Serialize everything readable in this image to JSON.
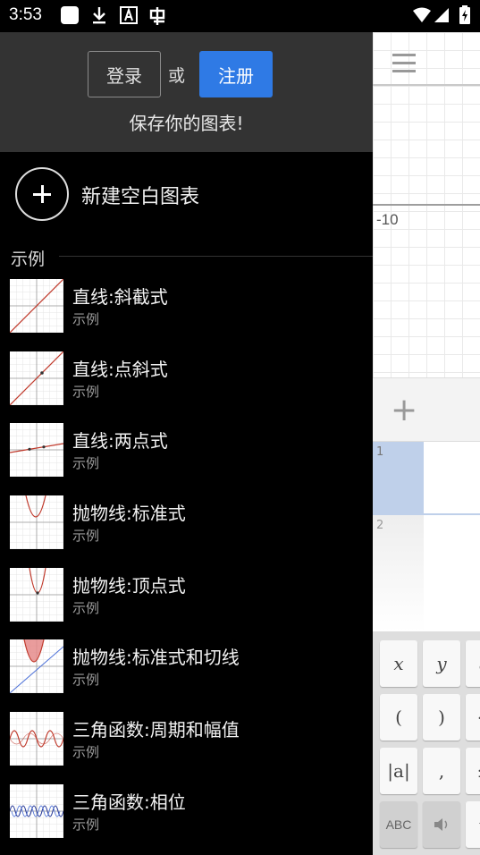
{
  "status_bar": {
    "time": "3:53",
    "icons": [
      "app-square-icon",
      "download-icon",
      "font-a-icon",
      "wechat-icon",
      "wifi-icon",
      "cell-signal-icon",
      "battery-charging-icon"
    ]
  },
  "drawer": {
    "login_label": "登录",
    "or_label": "或",
    "signup_label": "注册",
    "save_prompt": "保存你的图表!",
    "new_graph_label": "新建空白图表",
    "section_title": "示例",
    "examples": [
      {
        "title": "直线:斜截式",
        "subtitle": "示例",
        "thumb": "line-slope"
      },
      {
        "title": "直线:点斜式",
        "subtitle": "示例",
        "thumb": "line-point"
      },
      {
        "title": "直线:两点式",
        "subtitle": "示例",
        "thumb": "line-two-point"
      },
      {
        "title": "抛物线:标准式",
        "subtitle": "示例",
        "thumb": "parabola-standard"
      },
      {
        "title": "抛物线:顶点式",
        "subtitle": "示例",
        "thumb": "parabola-vertex"
      },
      {
        "title": "抛物线:标准式和切线",
        "subtitle": "示例",
        "thumb": "parabola-tangent"
      },
      {
        "title": "三角函数:周期和幅值",
        "subtitle": "示例",
        "thumb": "trig-period"
      },
      {
        "title": "三角函数:相位",
        "subtitle": "示例",
        "thumb": "trig-phase"
      }
    ]
  },
  "background_app": {
    "axis_tick": "-10",
    "add_symbol": "+",
    "expression_numbers": [
      "1",
      "2"
    ],
    "keypad": {
      "row1": [
        "x",
        "y",
        "a"
      ],
      "row2": [
        "(",
        ")",
        "<"
      ],
      "row3": [
        "|a|",
        ",",
        "≤"
      ],
      "row4": [
        "ABC",
        "speaker-icon",
        "√"
      ]
    }
  },
  "colors": {
    "accent": "#2f7ae5",
    "drawer_header": "#333333",
    "drawer_bg": "#000000",
    "curve_red": "#c0392b",
    "expression_highlight": "#bfd0ea"
  }
}
